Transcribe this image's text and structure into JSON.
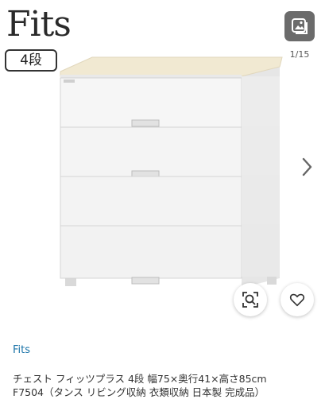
{
  "brand_logo": "Fits",
  "tier_badge": "4段",
  "gallery": {
    "counter": "1/15",
    "gallery_button_icon": "image-gallery-icon",
    "next_icon": "chevron-right-icon",
    "zoom_icon": "zoom-search-icon",
    "like_icon": "heart-icon"
  },
  "product": {
    "brand": "Fits",
    "title_line1": "チェスト フィッツプラス 4段 幅75×奥行41×高さ85cm",
    "title_line2": "F7504（タンス リビング収納 衣類収納 日本製 完成品）"
  },
  "colors": {
    "link": "#1a73a8",
    "badge_bg": "#6b6b6b",
    "top_board": "#f1e9d2"
  }
}
